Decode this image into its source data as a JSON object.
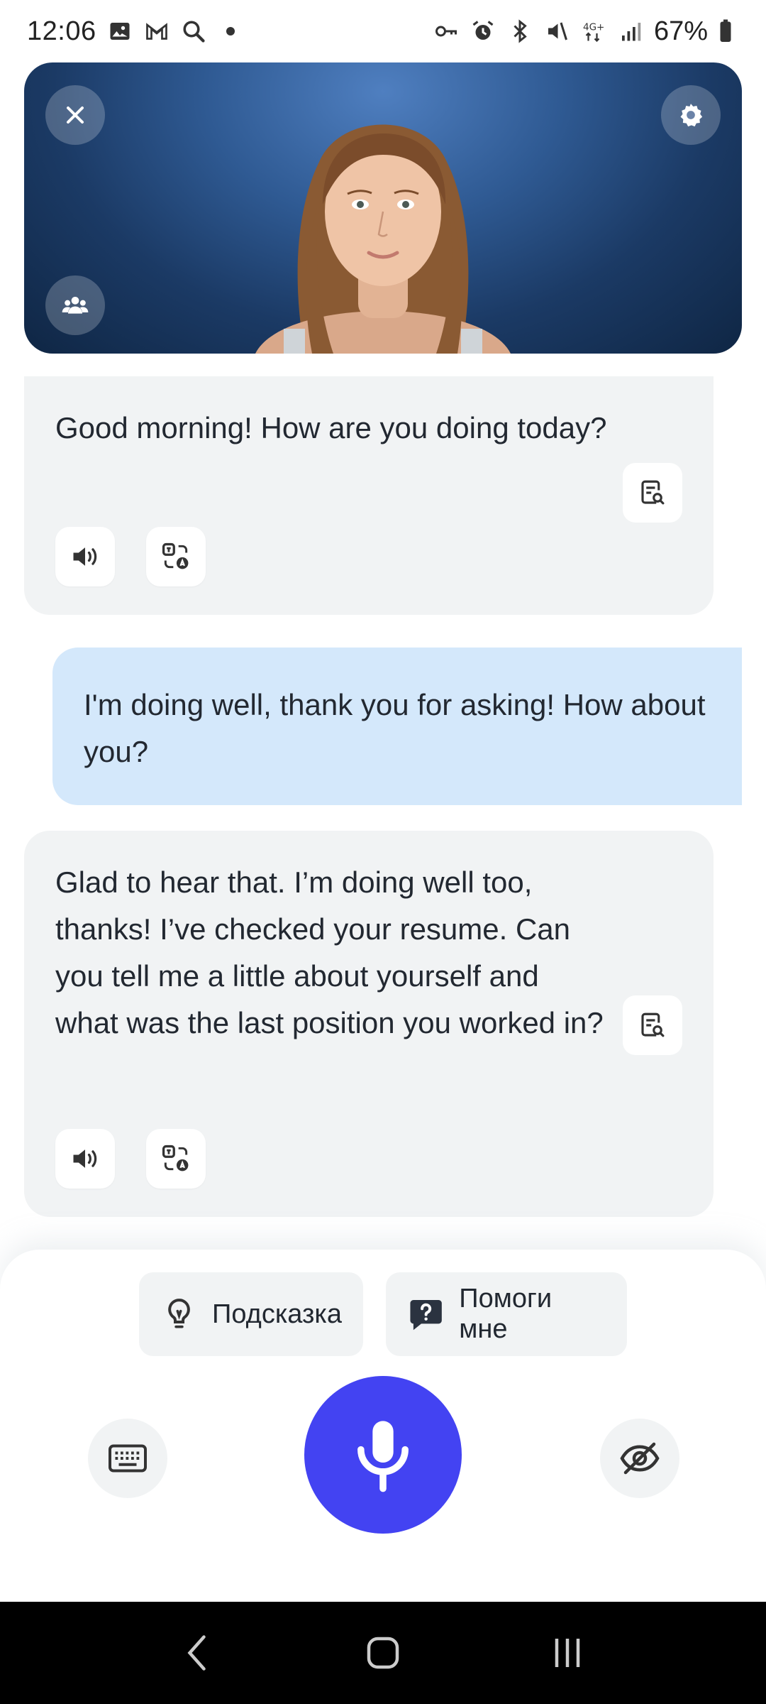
{
  "status_bar": {
    "time": "12:06",
    "battery": "67%",
    "left_icons": [
      "image-icon",
      "gmail-icon",
      "search-icon",
      "dot-icon"
    ],
    "right_icons": [
      "key-icon",
      "alarm-icon",
      "bluetooth-icon",
      "mute-icon",
      "4g-icon",
      "signal-icon"
    ]
  },
  "video": {
    "close_icon": "close-icon",
    "settings_icon": "gear-icon",
    "people_icon": "people-icon"
  },
  "messages": [
    {
      "role": "assistant",
      "text": "Good morning! How are you doing today?"
    },
    {
      "role": "user",
      "text": "I'm doing well, thank you for asking! How about you?"
    },
    {
      "role": "assistant",
      "text": "Glad to hear that. I’m doing well too, thanks! I’ve checked your resume. Can you tell me a little about yourself and what was the last position you worked in?"
    }
  ],
  "actions": {
    "hint_label": "Подсказка",
    "help_label": "Помоги мне"
  },
  "colors": {
    "accent": "#4343f2",
    "user_bubble": "#d4e8fb",
    "ai_bubble": "#f1f3f4"
  }
}
